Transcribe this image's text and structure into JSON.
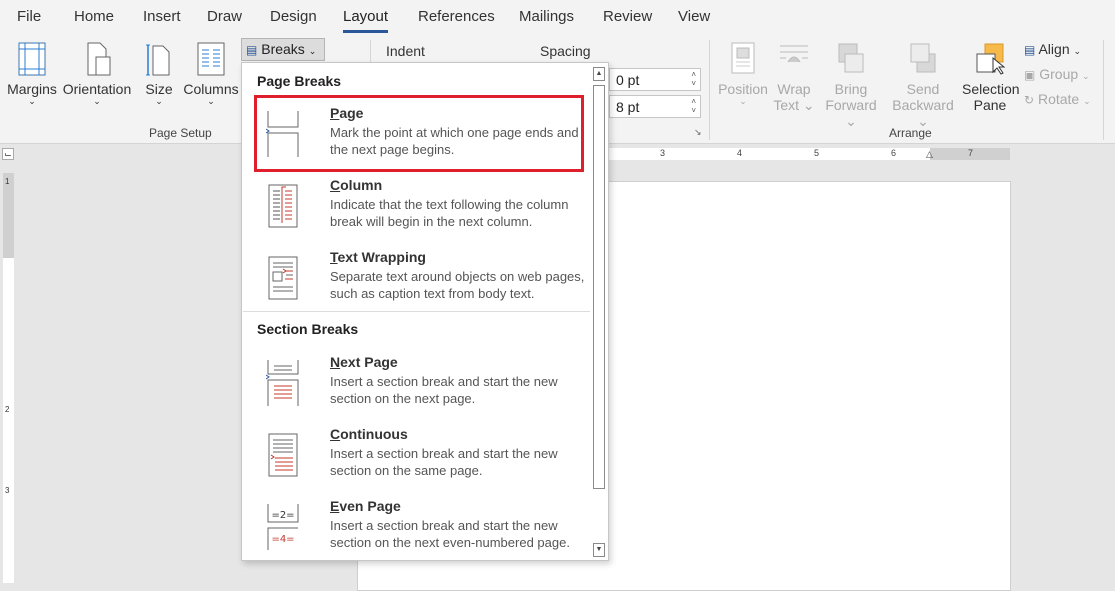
{
  "tabs": [
    "File",
    "Home",
    "Insert",
    "Draw",
    "Design",
    "Layout",
    "References",
    "Mailings",
    "Review",
    "View"
  ],
  "active_tab": "Layout",
  "ribbon": {
    "page_setup": {
      "margins": "Margins",
      "orientation": "Orientation",
      "size": "Size",
      "columns": "Columns",
      "breaks": "Breaks",
      "group_label": "Page Setup"
    },
    "paragraph": {
      "indent_label": "Indent",
      "spacing_label": "Spacing",
      "spacing_before": "0 pt",
      "spacing_after": "8 pt"
    },
    "arrange": {
      "position": "Position",
      "wrap_text_1": "Wrap",
      "wrap_text_2": "Text",
      "bring_forward_1": "Bring",
      "bring_forward_2": "Forward",
      "send_backward_1": "Send",
      "send_backward_2": "Backward",
      "selection_pane_1": "Selection",
      "selection_pane_2": "Pane",
      "align": "Align",
      "group": "Group",
      "rotate": "Rotate",
      "group_label": "Arrange"
    }
  },
  "ruler": {
    "h_marks": [
      "3",
      "4",
      "5",
      "6",
      "7"
    ],
    "v_marks": [
      "1",
      "2",
      "3"
    ]
  },
  "dropdown": {
    "page_breaks_heading": "Page Breaks",
    "section_breaks_heading": "Section Breaks",
    "items": [
      {
        "mnemonic": "P",
        "rest": "age",
        "desc": "Mark the point at which one page ends and the next page begins."
      },
      {
        "mnemonic": "C",
        "rest": "olumn",
        "desc": "Indicate that the text following the column break will begin in the next column."
      },
      {
        "mnemonic": "T",
        "rest": "ext Wrapping",
        "desc": "Separate text around objects on web pages, such as caption text from body text."
      },
      {
        "mnemonic": "N",
        "rest": "ext Page",
        "desc": "Insert a section break and start the new section on the next page."
      },
      {
        "mnemonic": "C",
        "rest": "ontinuous",
        "desc": "Insert a section break and start the new section on the same page."
      },
      {
        "mnemonic": "E",
        "rest": "ven Page",
        "desc": "Insert a section break and start the new section on the next even-numbered page."
      }
    ],
    "highlight_color": "#e01f2d"
  },
  "colors": {
    "accent": "#2b579a",
    "break_red": "#c0392b"
  }
}
